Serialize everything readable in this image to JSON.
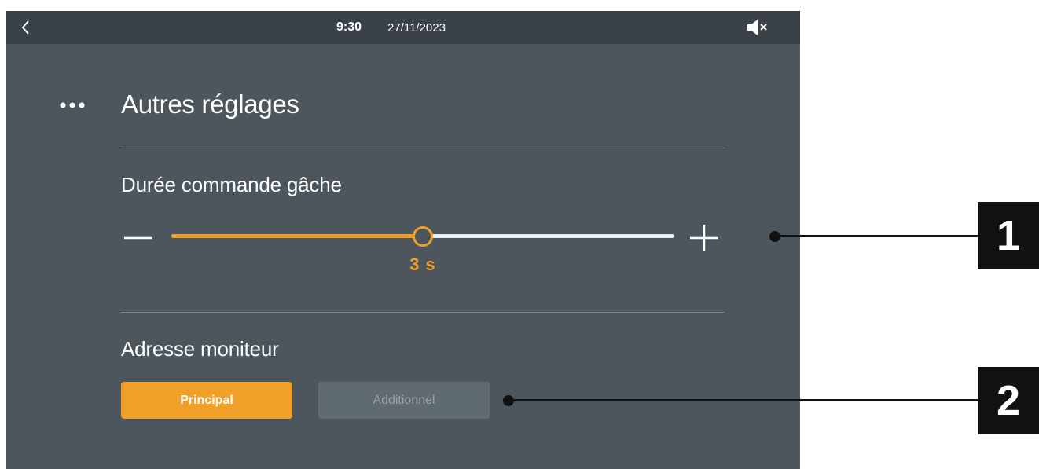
{
  "statusbar": {
    "time": "9:30",
    "date": "27/11/2023",
    "back_icon": "chevron-left-icon",
    "mute_icon": "speaker-muted-icon"
  },
  "header": {
    "menu_icon": "more-dots-icon",
    "title": "Autres réglages"
  },
  "strike_duration": {
    "label": "Durée commande gâche",
    "minus_icon": "minus-icon",
    "plus_icon": "plus-icon",
    "value_text": "3 s",
    "level_fraction": 0.5
  },
  "monitor_address": {
    "label": "Adresse moniteur",
    "options": [
      "Principal",
      "Additionnel"
    ],
    "selected": "Principal"
  },
  "callouts": [
    "1",
    "2"
  ],
  "colors": {
    "accent": "#f0a028",
    "screen_bg": "#4d555d",
    "statusbar_bg": "#3b4148",
    "inactive_button": "#606a71",
    "callout": "#111111"
  }
}
